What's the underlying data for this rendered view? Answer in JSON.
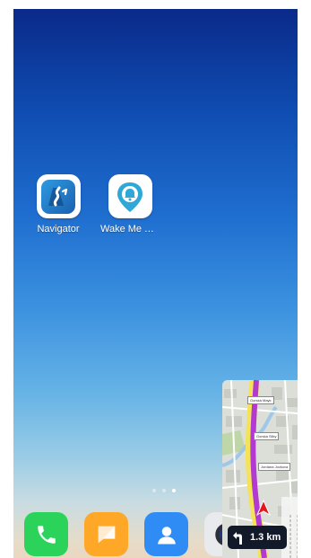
{
  "home_screen": {
    "apps": [
      {
        "label": "Navigator",
        "icon": "navigator-icon"
      },
      {
        "label": "Wake Me Th…",
        "icon": "wake-me-there-icon"
      }
    ],
    "page_indicator": {
      "pages": 3,
      "active": 3
    }
  },
  "dock": {
    "apps": [
      {
        "icon": "phone-icon",
        "color": "#2bd35a"
      },
      {
        "icon": "messages-icon",
        "color": "#ffa726"
      },
      {
        "icon": "contacts-icon",
        "color": "#2f8cf5"
      },
      {
        "icon": "camera-icon",
        "color": "#e9eaee"
      },
      {
        "icon": "browser-icon",
        "color": "#f1f1f1"
      }
    ]
  },
  "navigation_overlay": {
    "distance": "1.3 km",
    "turn_icon": "turn-left-arrow-icon",
    "streets": [
      "Gorská Mayk",
      "Gorská Silky",
      "Jordana Jovkova"
    ]
  }
}
